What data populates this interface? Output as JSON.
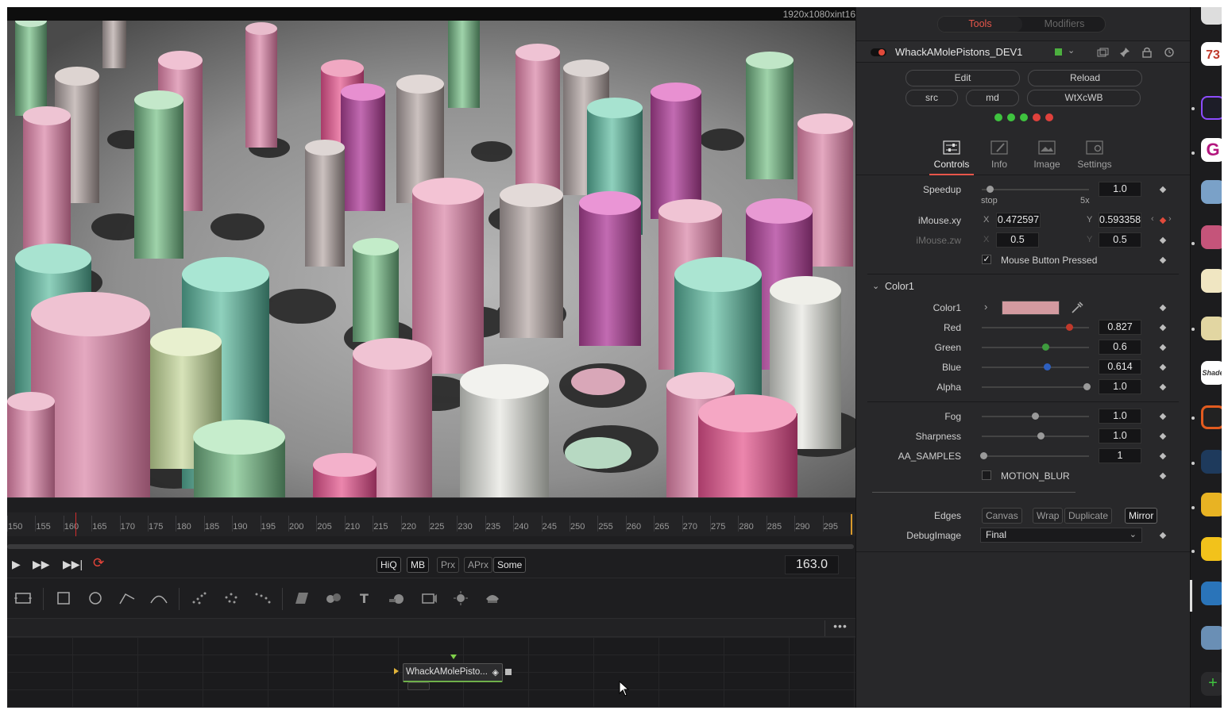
{
  "viewer": {
    "resolution_label": "1920x1080xint16"
  },
  "timeline": {
    "ticks": [
      "150",
      "155",
      "160",
      "165",
      "170",
      "175",
      "180",
      "185",
      "190",
      "195",
      "200",
      "205",
      "210",
      "215",
      "220",
      "225",
      "230",
      "235",
      "240",
      "245",
      "250",
      "255",
      "260",
      "265",
      "270",
      "275",
      "280",
      "285",
      "290",
      "295"
    ]
  },
  "transport": {
    "quality_buttons": [
      {
        "label": "HiQ",
        "on": true
      },
      {
        "label": "MB",
        "on": true
      },
      {
        "label": "Prx",
        "on": false
      },
      {
        "label": "APrx",
        "on": false
      },
      {
        "label": "Some",
        "on": true
      }
    ],
    "current_frame": "163.0"
  },
  "node": {
    "label": "WhackAMolePisto..."
  },
  "inspector": {
    "tabs": {
      "tools": "Tools",
      "modifiers": "Modifiers"
    },
    "tool_name": "WhackAMolePistons_DEV1",
    "buttons": {
      "edit": "Edit",
      "reload": "Reload",
      "src": "src",
      "md": "md",
      "wtxcwb": "WtXcWB"
    },
    "led_colors": [
      "#3fc33f",
      "#3fc33f",
      "#3fc33f",
      "#e0413c",
      "#e0413c"
    ],
    "control_tabs": [
      "Controls",
      "Info",
      "Image",
      "Settings"
    ],
    "speedup": {
      "label": "Speedup",
      "value": "1.0",
      "min_label": "stop",
      "max_label": "5x",
      "level": 0.06
    },
    "imouse_xy": {
      "label": "iMouse.xy",
      "x_label": "X",
      "x": "0.472597",
      "y_label": "Y",
      "y": "0.593358"
    },
    "imouse_zw": {
      "label": "iMouse.zw",
      "x_label": "X",
      "x": "0.5",
      "y_label": "Y",
      "y": "0.5"
    },
    "mouse_pressed": {
      "label": "Mouse Button Pressed",
      "checked": true
    },
    "color_group": {
      "title": "Color1",
      "color_label": "Color1",
      "swatch": "#d39aa0",
      "red": {
        "label": "Red",
        "value": "0.827",
        "level": 0.827
      },
      "green": {
        "label": "Green",
        "value": "0.6",
        "level": 0.6
      },
      "blue": {
        "label": "Blue",
        "value": "0.614",
        "level": 0.614
      },
      "alpha": {
        "label": "Alpha",
        "value": "1.0",
        "level": 1.0
      }
    },
    "fog": {
      "label": "Fog",
      "value": "1.0",
      "level": 0.5
    },
    "sharpness": {
      "label": "Sharpness",
      "value": "1.0",
      "level": 0.55
    },
    "aa_samples": {
      "label": "AA_SAMPLES",
      "value": "1",
      "level": 0.0
    },
    "motion_blur": {
      "label": "MOTION_BLUR",
      "checked": false
    },
    "edges": {
      "label": "Edges",
      "options": [
        "Canvas",
        "Wrap",
        "Duplicate",
        "Mirror"
      ],
      "selected": "Mirror"
    },
    "debug_image": {
      "label": "DebugImage",
      "value": "Final"
    }
  },
  "dock": {
    "badge_text": "73",
    "app_letter": "G",
    "shade_text": "Shade"
  }
}
